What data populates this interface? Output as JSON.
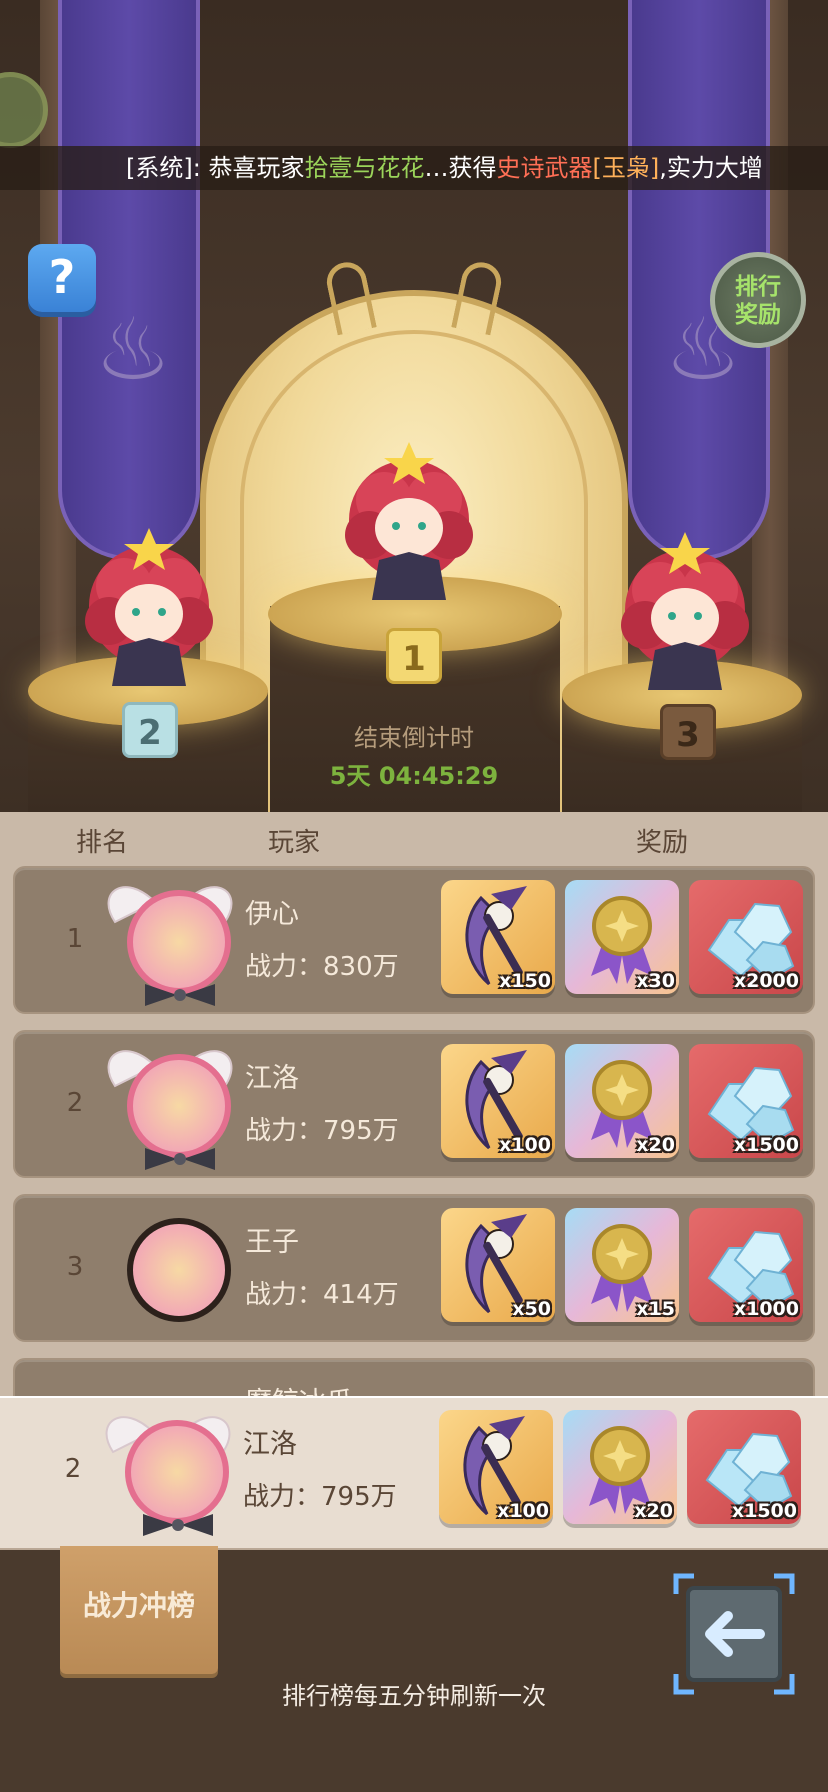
{
  "ticker": {
    "prefix": "[系统]: 恭喜玩家",
    "player": "拾壹与花花",
    "mid": "…获得",
    "weapon": "史诗武器",
    "item": "[玉枭]",
    "suffix": ",实力大增"
  },
  "buttons": {
    "help": "?",
    "rank_reward": "排行\n奖励",
    "climb": "战力冲榜"
  },
  "podium": {
    "first_rank": "1",
    "second_rank": "2",
    "third_rank": "3",
    "countdown_label": "结束倒计时",
    "countdown_value": "5天 04:45:29"
  },
  "table": {
    "col_rank": "排名",
    "col_player": "玩家",
    "col_reward": "奖励",
    "rows": [
      {
        "rank": "1",
        "name": "伊心",
        "power": "战力：830万",
        "rewards": [
          "x150",
          "x30",
          "x2000"
        ]
      },
      {
        "rank": "2",
        "name": "江洛",
        "power": "战力：795万",
        "rewards": [
          "x100",
          "x20",
          "x1500"
        ]
      },
      {
        "rank": "3",
        "name": "王子",
        "power": "战力：414万",
        "rewards": [
          "x50",
          "x15",
          "x1000"
        ]
      }
    ],
    "partial_row_name": "魔鲸冰瓜"
  },
  "my_row": {
    "rank": "2",
    "name": "江洛",
    "power": "战力：795万",
    "rewards": [
      "x100",
      "x20",
      "x1500"
    ]
  },
  "footer": {
    "refresh_note": "排行榜每五分钟刷新一次"
  }
}
